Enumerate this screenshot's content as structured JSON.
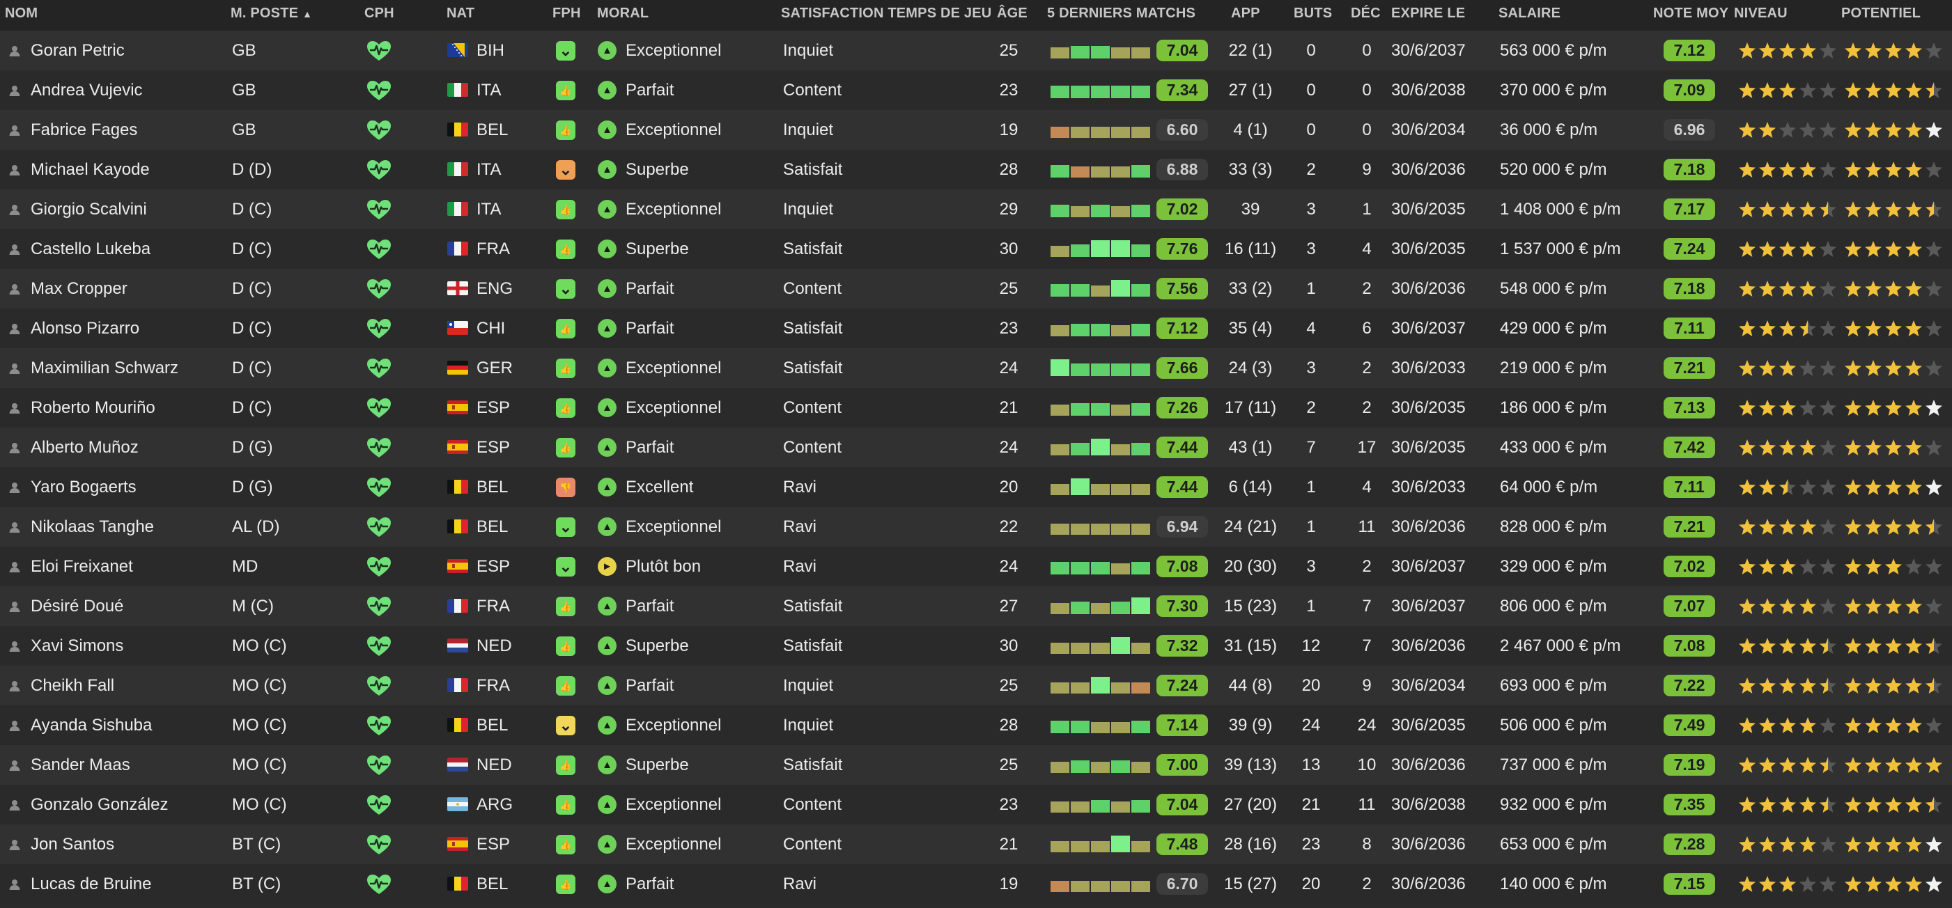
{
  "headers": {
    "nom": "NOM",
    "poste": "M. POSTE",
    "cph": "CPH",
    "nat": "NAT",
    "fph": "FPH",
    "moral": "MORAL",
    "satisfaction": "SATISFACTION TEMPS DE JEU",
    "age": "ÂGE",
    "form": "5 DERNIERS MATCHS",
    "app": "APP",
    "buts": "BUTS",
    "dec": "DÉC",
    "expire": "EXPIRE LE",
    "salaire": "SALAIRE",
    "note": "NOTE MOY",
    "niveau": "NIVEAU",
    "potentiel": "POTENTIEL",
    "sort_indicator": "▲"
  },
  "colors": {
    "cph_green": "#6fe07a",
    "pill_green": "#7bc23a",
    "pill_grey": "#3c3c3c",
    "star_gold": "#f2c13b",
    "star_white": "#f2f2f2",
    "star_empty": "#595959",
    "fph_green": "#6fdc5e",
    "fph_yellow": "#f0d65a",
    "fph_orange": "#f0a055",
    "fph_salmon": "#e88a6a",
    "moral_green": "#6ed158",
    "moral_yellow": "#e8d24a"
  },
  "players": [
    {
      "name": "Goran Petric",
      "pos": "GB",
      "nat_code": "BIH",
      "flag": "bih",
      "fph": "chevron-down",
      "fph_color": "green",
      "moral": "Exceptionnel",
      "moral_icon": "up",
      "moral_color": "green",
      "sat": "Inquiet",
      "age": "25",
      "form": [
        "o",
        "g",
        "g",
        "o",
        "o"
      ],
      "note5": "7.04",
      "note5_pill": "green",
      "app": "22 (1)",
      "buts": "0",
      "dec": "0",
      "expire": "30/6/2037",
      "salaire": "563 000 € p/m",
      "note": "7.12",
      "note_pill": "green",
      "niveau": [
        4,
        0
      ],
      "potentiel": [
        4,
        0
      ]
    },
    {
      "name": "Andrea Vujevic",
      "pos": "GB",
      "nat_code": "ITA",
      "flag": "ita",
      "fph": "thumb-up",
      "fph_color": "green",
      "moral": "Parfait",
      "moral_icon": "up",
      "moral_color": "green",
      "sat": "Content",
      "age": "23",
      "form": [
        "g",
        "g",
        "g",
        "g",
        "g"
      ],
      "note5": "7.34",
      "note5_pill": "green",
      "app": "27 (1)",
      "buts": "0",
      "dec": "0",
      "expire": "30/6/2038",
      "salaire": "370 000 € p/m",
      "note": "7.09",
      "note_pill": "green",
      "niveau": [
        3,
        0
      ],
      "potentiel": [
        4.5,
        0
      ]
    },
    {
      "name": "Fabrice Fages",
      "pos": "GB",
      "nat_code": "BEL",
      "flag": "bel",
      "fph": "thumb-up",
      "fph_color": "green",
      "moral": "Exceptionnel",
      "moral_icon": "up",
      "moral_color": "green",
      "sat": "Inquiet",
      "age": "19",
      "form": [
        "t",
        "o",
        "o",
        "o",
        "o"
      ],
      "note5": "6.60",
      "note5_pill": "grey",
      "app": "4 (1)",
      "buts": "0",
      "dec": "0",
      "expire": "30/6/2034",
      "salaire": "36 000 € p/m",
      "note": "6.96",
      "note_pill": "grey",
      "niveau": [
        2,
        0
      ],
      "potentiel": [
        4,
        1
      ]
    },
    {
      "name": "Michael Kayode",
      "pos": "D (D)",
      "nat_code": "ITA",
      "flag": "ita",
      "fph": "chevron-down",
      "fph_color": "orange",
      "moral": "Superbe",
      "moral_icon": "up",
      "moral_color": "green",
      "sat": "Satisfait",
      "age": "28",
      "form": [
        "g",
        "t",
        "o",
        "o",
        "g"
      ],
      "note5": "6.88",
      "note5_pill": "grey",
      "app": "33 (3)",
      "buts": "2",
      "dec": "9",
      "expire": "30/6/2036",
      "salaire": "520 000 € p/m",
      "note": "7.18",
      "note_pill": "green",
      "niveau": [
        4,
        0
      ],
      "potentiel": [
        4,
        0
      ]
    },
    {
      "name": "Giorgio Scalvini",
      "pos": "D (C)",
      "nat_code": "ITA",
      "flag": "ita",
      "fph": "thumb-up",
      "fph_color": "green",
      "moral": "Exceptionnel",
      "moral_icon": "up",
      "moral_color": "green",
      "sat": "Inquiet",
      "age": "29",
      "form": [
        "g",
        "o",
        "g",
        "o",
        "g"
      ],
      "note5": "7.02",
      "note5_pill": "green",
      "app": "39",
      "buts": "3",
      "dec": "1",
      "expire": "30/6/2035",
      "salaire": "1 408 000 € p/m",
      "note": "7.17",
      "note_pill": "green",
      "niveau": [
        4.5,
        0
      ],
      "potentiel": [
        4.5,
        0
      ]
    },
    {
      "name": "Castello Lukeba",
      "pos": "D (C)",
      "nat_code": "FRA",
      "flag": "fra",
      "fph": "thumb-up",
      "fph_color": "green",
      "moral": "Superbe",
      "moral_icon": "up",
      "moral_color": "green",
      "sat": "Satisfait",
      "age": "30",
      "form": [
        "o",
        "g",
        "b",
        "b",
        "g"
      ],
      "note5": "7.76",
      "note5_pill": "green",
      "app": "16 (11)",
      "buts": "3",
      "dec": "4",
      "expire": "30/6/2035",
      "salaire": "1 537 000 € p/m",
      "note": "7.24",
      "note_pill": "green",
      "niveau": [
        4,
        0
      ],
      "potentiel": [
        4,
        0
      ]
    },
    {
      "name": "Max Cropper",
      "pos": "D (C)",
      "nat_code": "ENG",
      "flag": "eng",
      "fph": "chevron-down",
      "fph_color": "green",
      "moral": "Parfait",
      "moral_icon": "up",
      "moral_color": "green",
      "sat": "Content",
      "age": "25",
      "form": [
        "g",
        "g",
        "o",
        "b",
        "g"
      ],
      "note5": "7.56",
      "note5_pill": "green",
      "app": "33 (2)",
      "buts": "1",
      "dec": "2",
      "expire": "30/6/2036",
      "salaire": "548 000 € p/m",
      "note": "7.18",
      "note_pill": "green",
      "niveau": [
        4,
        0
      ],
      "potentiel": [
        4,
        0
      ]
    },
    {
      "name": "Alonso Pizarro",
      "pos": "D (C)",
      "nat_code": "CHI",
      "flag": "chi",
      "fph": "thumb-up",
      "fph_color": "green",
      "moral": "Parfait",
      "moral_icon": "up",
      "moral_color": "green",
      "sat": "Satisfait",
      "age": "23",
      "form": [
        "o",
        "g",
        "g",
        "o",
        "g"
      ],
      "note5": "7.12",
      "note5_pill": "green",
      "app": "35 (4)",
      "buts": "4",
      "dec": "6",
      "expire": "30/6/2037",
      "salaire": "429 000 € p/m",
      "note": "7.11",
      "note_pill": "green",
      "niveau": [
        3.5,
        0
      ],
      "potentiel": [
        4,
        0
      ]
    },
    {
      "name": "Maximilian Schwarz",
      "pos": "D (C)",
      "nat_code": "GER",
      "flag": "ger",
      "fph": "thumb-up",
      "fph_color": "green",
      "moral": "Exceptionnel",
      "moral_icon": "up",
      "moral_color": "green",
      "sat": "Satisfait",
      "age": "24",
      "form": [
        "b",
        "g",
        "g",
        "g",
        "g"
      ],
      "note5": "7.66",
      "note5_pill": "green",
      "app": "24 (3)",
      "buts": "3",
      "dec": "2",
      "expire": "30/6/2033",
      "salaire": "219 000 € p/m",
      "note": "7.21",
      "note_pill": "green",
      "niveau": [
        3,
        0
      ],
      "potentiel": [
        4,
        0
      ]
    },
    {
      "name": "Roberto Mouriño",
      "pos": "D (C)",
      "nat_code": "ESP",
      "flag": "esp",
      "fph": "thumb-up",
      "fph_color": "green",
      "moral": "Exceptionnel",
      "moral_icon": "up",
      "moral_color": "green",
      "sat": "Content",
      "age": "21",
      "form": [
        "o",
        "g",
        "g",
        "o",
        "g"
      ],
      "note5": "7.26",
      "note5_pill": "green",
      "app": "17 (11)",
      "buts": "2",
      "dec": "2",
      "expire": "30/6/2035",
      "salaire": "186 000 € p/m",
      "note": "7.13",
      "note_pill": "green",
      "niveau": [
        3,
        0
      ],
      "potentiel": [
        4,
        1
      ]
    },
    {
      "name": "Alberto Muñoz",
      "pos": "D (G)",
      "nat_code": "ESP",
      "flag": "esp",
      "fph": "thumb-up",
      "fph_color": "green",
      "moral": "Parfait",
      "moral_icon": "up",
      "moral_color": "green",
      "sat": "Content",
      "age": "24",
      "form": [
        "o",
        "g",
        "b",
        "o",
        "g"
      ],
      "note5": "7.44",
      "note5_pill": "green",
      "app": "43 (1)",
      "buts": "7",
      "dec": "17",
      "expire": "30/6/2035",
      "salaire": "433 000 € p/m",
      "note": "7.42",
      "note_pill": "green",
      "niveau": [
        4,
        0
      ],
      "potentiel": [
        4,
        0
      ]
    },
    {
      "name": "Yaro Bogaerts",
      "pos": "D (G)",
      "nat_code": "BEL",
      "flag": "bel",
      "fph": "thumb-down",
      "fph_color": "salmon",
      "moral": "Excellent",
      "moral_icon": "up",
      "moral_color": "green",
      "sat": "Ravi",
      "age": "20",
      "form": [
        "o",
        "b",
        "o",
        "o",
        "o"
      ],
      "note5": "7.44",
      "note5_pill": "green",
      "app": "6 (14)",
      "buts": "1",
      "dec": "4",
      "expire": "30/6/2033",
      "salaire": "64 000 € p/m",
      "note": "7.11",
      "note_pill": "green",
      "niveau": [
        2.5,
        0
      ],
      "potentiel": [
        4,
        1
      ]
    },
    {
      "name": "Nikolaas Tanghe",
      "pos": "AL (D)",
      "nat_code": "BEL",
      "flag": "bel",
      "fph": "chevron-down",
      "fph_color": "green",
      "moral": "Exceptionnel",
      "moral_icon": "up",
      "moral_color": "green",
      "sat": "Ravi",
      "age": "22",
      "form": [
        "o",
        "o",
        "o",
        "o",
        "o"
      ],
      "note5": "6.94",
      "note5_pill": "grey",
      "app": "24 (21)",
      "buts": "1",
      "dec": "11",
      "expire": "30/6/2036",
      "salaire": "828 000 € p/m",
      "note": "7.21",
      "note_pill": "green",
      "niveau": [
        4,
        0
      ],
      "potentiel": [
        4.5,
        0
      ]
    },
    {
      "name": "Eloi Freixanet",
      "pos": "MD",
      "nat_code": "ESP",
      "flag": "esp",
      "fph": "chevron-down",
      "fph_color": "green",
      "moral": "Plutôt bon",
      "moral_icon": "right",
      "moral_color": "yellow",
      "sat": "Ravi",
      "age": "24",
      "form": [
        "g",
        "g",
        "g",
        "o",
        "g"
      ],
      "note5": "7.08",
      "note5_pill": "green",
      "app": "20 (30)",
      "buts": "3",
      "dec": "2",
      "expire": "30/6/2037",
      "salaire": "329 000 € p/m",
      "note": "7.02",
      "note_pill": "green",
      "niveau": [
        3,
        0
      ],
      "potentiel": [
        3,
        0
      ]
    },
    {
      "name": "Désiré Doué",
      "pos": "M (C)",
      "nat_code": "FRA",
      "flag": "fra",
      "fph": "thumb-up",
      "fph_color": "green",
      "moral": "Parfait",
      "moral_icon": "up",
      "moral_color": "green",
      "sat": "Satisfait",
      "age": "27",
      "form": [
        "o",
        "g",
        "o",
        "g",
        "b"
      ],
      "note5": "7.30",
      "note5_pill": "green",
      "app": "15 (23)",
      "buts": "1",
      "dec": "7",
      "expire": "30/6/2037",
      "salaire": "806 000 € p/m",
      "note": "7.07",
      "note_pill": "green",
      "niveau": [
        4,
        0
      ],
      "potentiel": [
        4,
        0
      ]
    },
    {
      "name": "Xavi Simons",
      "pos": "MO (C)",
      "nat_code": "NED",
      "flag": "ned",
      "fph": "thumb-up",
      "fph_color": "green",
      "moral": "Superbe",
      "moral_icon": "up",
      "moral_color": "green",
      "sat": "Satisfait",
      "age": "30",
      "form": [
        "o",
        "o",
        "o",
        "b",
        "o"
      ],
      "note5": "7.32",
      "note5_pill": "green",
      "app": "31 (15)",
      "buts": "12",
      "dec": "7",
      "expire": "30/6/2036",
      "salaire": "2 467 000 € p/m",
      "note": "7.08",
      "note_pill": "green",
      "niveau": [
        4.5,
        0
      ],
      "potentiel": [
        4.5,
        0
      ]
    },
    {
      "name": "Cheikh Fall",
      "pos": "MO (C)",
      "nat_code": "FRA",
      "flag": "fra",
      "fph": "thumb-up",
      "fph_color": "green",
      "moral": "Parfait",
      "moral_icon": "up",
      "moral_color": "green",
      "sat": "Inquiet",
      "age": "25",
      "form": [
        "o",
        "o",
        "b",
        "o",
        "t"
      ],
      "note5": "7.24",
      "note5_pill": "green",
      "app": "44 (8)",
      "buts": "20",
      "dec": "9",
      "expire": "30/6/2034",
      "salaire": "693 000 € p/m",
      "note": "7.22",
      "note_pill": "green",
      "niveau": [
        4.5,
        0
      ],
      "potentiel": [
        4.5,
        0
      ]
    },
    {
      "name": "Ayanda Sishuba",
      "pos": "MO (C)",
      "nat_code": "BEL",
      "flag": "bel",
      "fph": "chevron-down",
      "fph_color": "yellow",
      "moral": "Exceptionnel",
      "moral_icon": "up",
      "moral_color": "green",
      "sat": "Inquiet",
      "age": "28",
      "form": [
        "g",
        "g",
        "o",
        "o",
        "g"
      ],
      "note5": "7.14",
      "note5_pill": "green",
      "app": "39 (9)",
      "buts": "24",
      "dec": "24",
      "expire": "30/6/2035",
      "salaire": "506 000 € p/m",
      "note": "7.49",
      "note_pill": "green",
      "niveau": [
        4,
        0
      ],
      "potentiel": [
        4,
        0
      ]
    },
    {
      "name": "Sander Maas",
      "pos": "MO (C)",
      "nat_code": "NED",
      "flag": "ned",
      "fph": "thumb-up",
      "fph_color": "green",
      "moral": "Superbe",
      "moral_icon": "up",
      "moral_color": "green",
      "sat": "Satisfait",
      "age": "25",
      "form": [
        "o",
        "g",
        "o",
        "g",
        "o"
      ],
      "note5": "7.00",
      "note5_pill": "green",
      "app": "39 (13)",
      "buts": "13",
      "dec": "10",
      "expire": "30/6/2036",
      "salaire": "737 000 € p/m",
      "note": "7.19",
      "note_pill": "green",
      "niveau": [
        4.5,
        0
      ],
      "potentiel": [
        5,
        0
      ]
    },
    {
      "name": "Gonzalo González",
      "pos": "MO (C)",
      "nat_code": "ARG",
      "flag": "arg",
      "fph": "thumb-up",
      "fph_color": "green",
      "moral": "Exceptionnel",
      "moral_icon": "up",
      "moral_color": "green",
      "sat": "Content",
      "age": "23",
      "form": [
        "o",
        "o",
        "g",
        "o",
        "g"
      ],
      "note5": "7.04",
      "note5_pill": "green",
      "app": "27 (20)",
      "buts": "21",
      "dec": "11",
      "expire": "30/6/2038",
      "salaire": "932 000 € p/m",
      "note": "7.35",
      "note_pill": "green",
      "niveau": [
        4.5,
        0
      ],
      "potentiel": [
        4.5,
        0
      ]
    },
    {
      "name": "Jon Santos",
      "pos": "BT (C)",
      "nat_code": "ESP",
      "flag": "esp",
      "fph": "thumb-up",
      "fph_color": "green",
      "moral": "Exceptionnel",
      "moral_icon": "up",
      "moral_color": "green",
      "sat": "Content",
      "age": "21",
      "form": [
        "o",
        "o",
        "o",
        "b",
        "o"
      ],
      "note5": "7.48",
      "note5_pill": "green",
      "app": "28 (16)",
      "buts": "23",
      "dec": "8",
      "expire": "30/6/2036",
      "salaire": "653 000 € p/m",
      "note": "7.28",
      "note_pill": "green",
      "niveau": [
        4,
        0
      ],
      "potentiel": [
        4,
        1
      ]
    },
    {
      "name": "Lucas de Bruine",
      "pos": "BT (C)",
      "nat_code": "BEL",
      "flag": "bel",
      "fph": "thumb-up",
      "fph_color": "green",
      "moral": "Parfait",
      "moral_icon": "up",
      "moral_color": "green",
      "sat": "Ravi",
      "age": "19",
      "form": [
        "t",
        "o",
        "o",
        "o",
        "o"
      ],
      "note5": "6.70",
      "note5_pill": "grey",
      "app": "15 (27)",
      "buts": "20",
      "dec": "2",
      "expire": "30/6/2036",
      "salaire": "140 000 € p/m",
      "note": "7.15",
      "note_pill": "green",
      "niveau": [
        3,
        0
      ],
      "potentiel": [
        4,
        1
      ]
    }
  ]
}
